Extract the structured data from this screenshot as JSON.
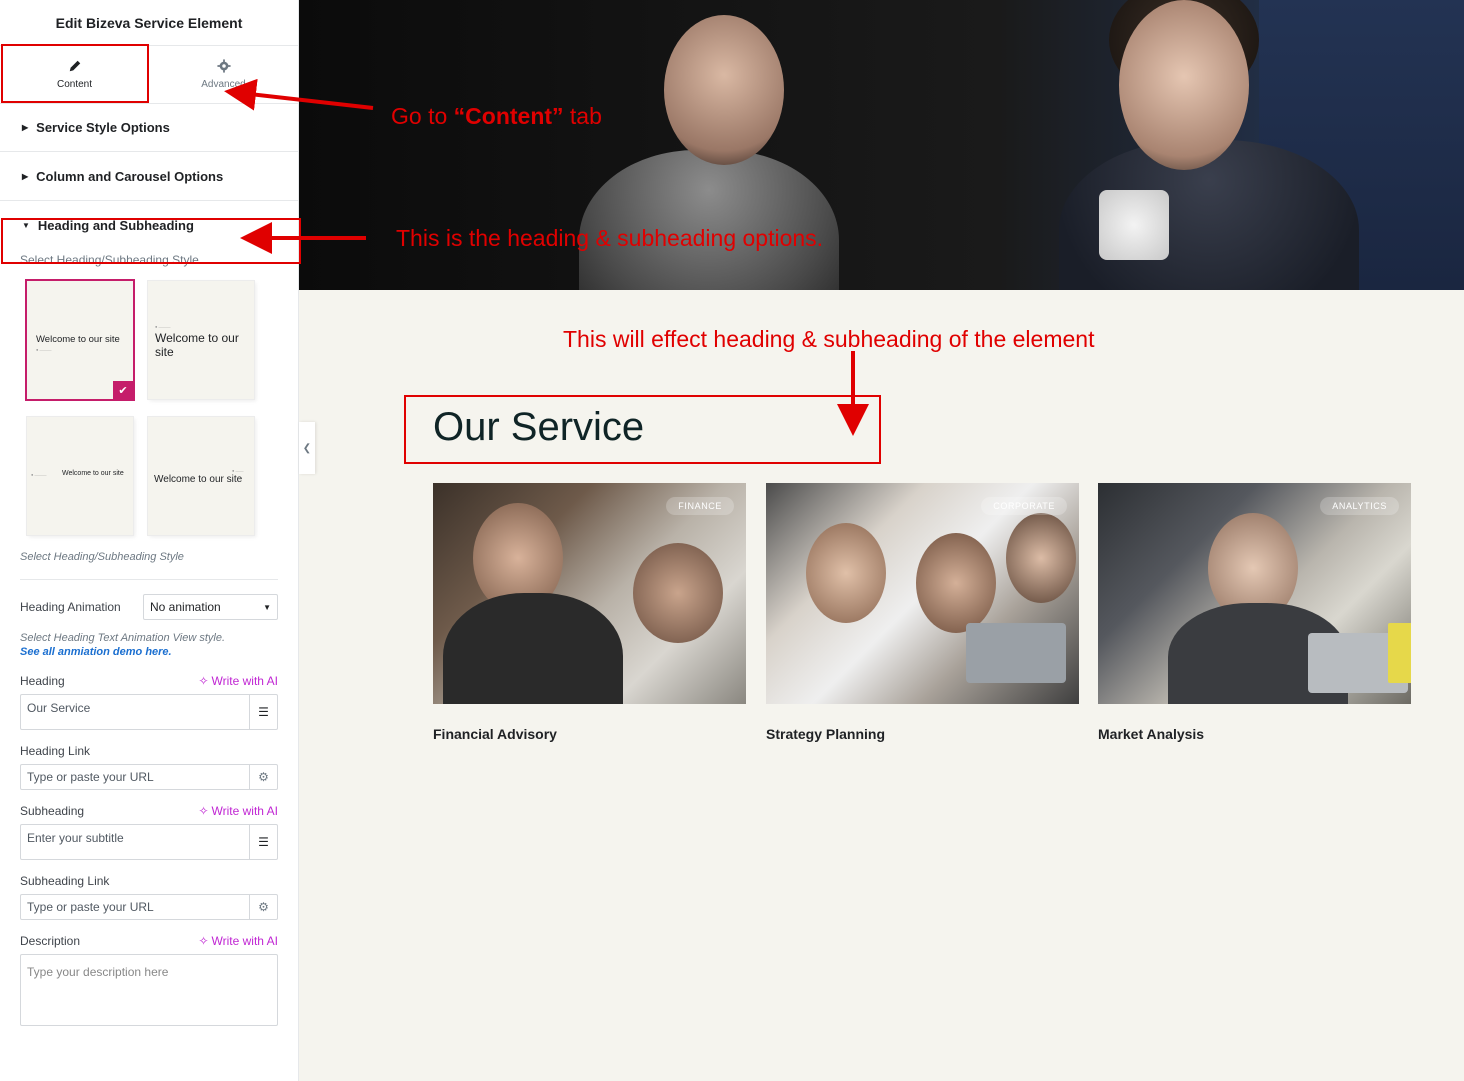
{
  "panel": {
    "title": "Edit Bizeva Service Element",
    "tabs": [
      {
        "label": "Content",
        "icon": "pencil-icon"
      },
      {
        "label": "Advanced",
        "icon": "gear-icon"
      }
    ],
    "sections": [
      {
        "label": "Service Style Options"
      },
      {
        "label": "Column and Carousel Options"
      },
      {
        "label": "Heading and Subheading"
      }
    ],
    "style_select_label": "Select Heading/Subheading Style",
    "style_cards": [
      {
        "text": "Welcome to our site",
        "selected": true
      },
      {
        "text": "Welcome to our site",
        "selected": false
      },
      {
        "text": "Welcome to our site",
        "selected": false
      },
      {
        "text": "Welcome to our site",
        "selected": false
      }
    ],
    "style_help": "Select Heading/Subheading Style",
    "animation": {
      "label": "Heading Animation",
      "value": "No animation",
      "help": "Select Heading Text Animation View style.",
      "link": "See all anmiation demo here."
    },
    "write_ai": "Write with AI",
    "heading": {
      "label": "Heading",
      "value": "Our Service"
    },
    "heading_link": {
      "label": "Heading Link",
      "placeholder": "Type or paste your URL"
    },
    "subheading": {
      "label": "Subheading",
      "placeholder": "Enter your subtitle"
    },
    "subheading_link": {
      "label": "Subheading Link",
      "placeholder": "Type or paste your URL"
    },
    "description": {
      "label": "Description",
      "placeholder": "Type your description here"
    }
  },
  "main": {
    "section_title": "Our Service",
    "cards": [
      {
        "badge": "FINANCE",
        "title": "Financial Advisory"
      },
      {
        "badge": "CORPORATE",
        "title": "Strategy Planning"
      },
      {
        "badge": "ANALYTICS",
        "title": "Market Analysis"
      }
    ]
  },
  "annotations": {
    "goto_prefix": "Go  to ",
    "goto_bold": "“Content”",
    "goto_suffix": " tab",
    "heading_options": "This is the heading & subheading options.",
    "effect": "This will effect heading & subheading of the element"
  },
  "colors": {
    "accent": "#c51d6a",
    "annotation": "#e00000",
    "ai": "#c026d3"
  }
}
